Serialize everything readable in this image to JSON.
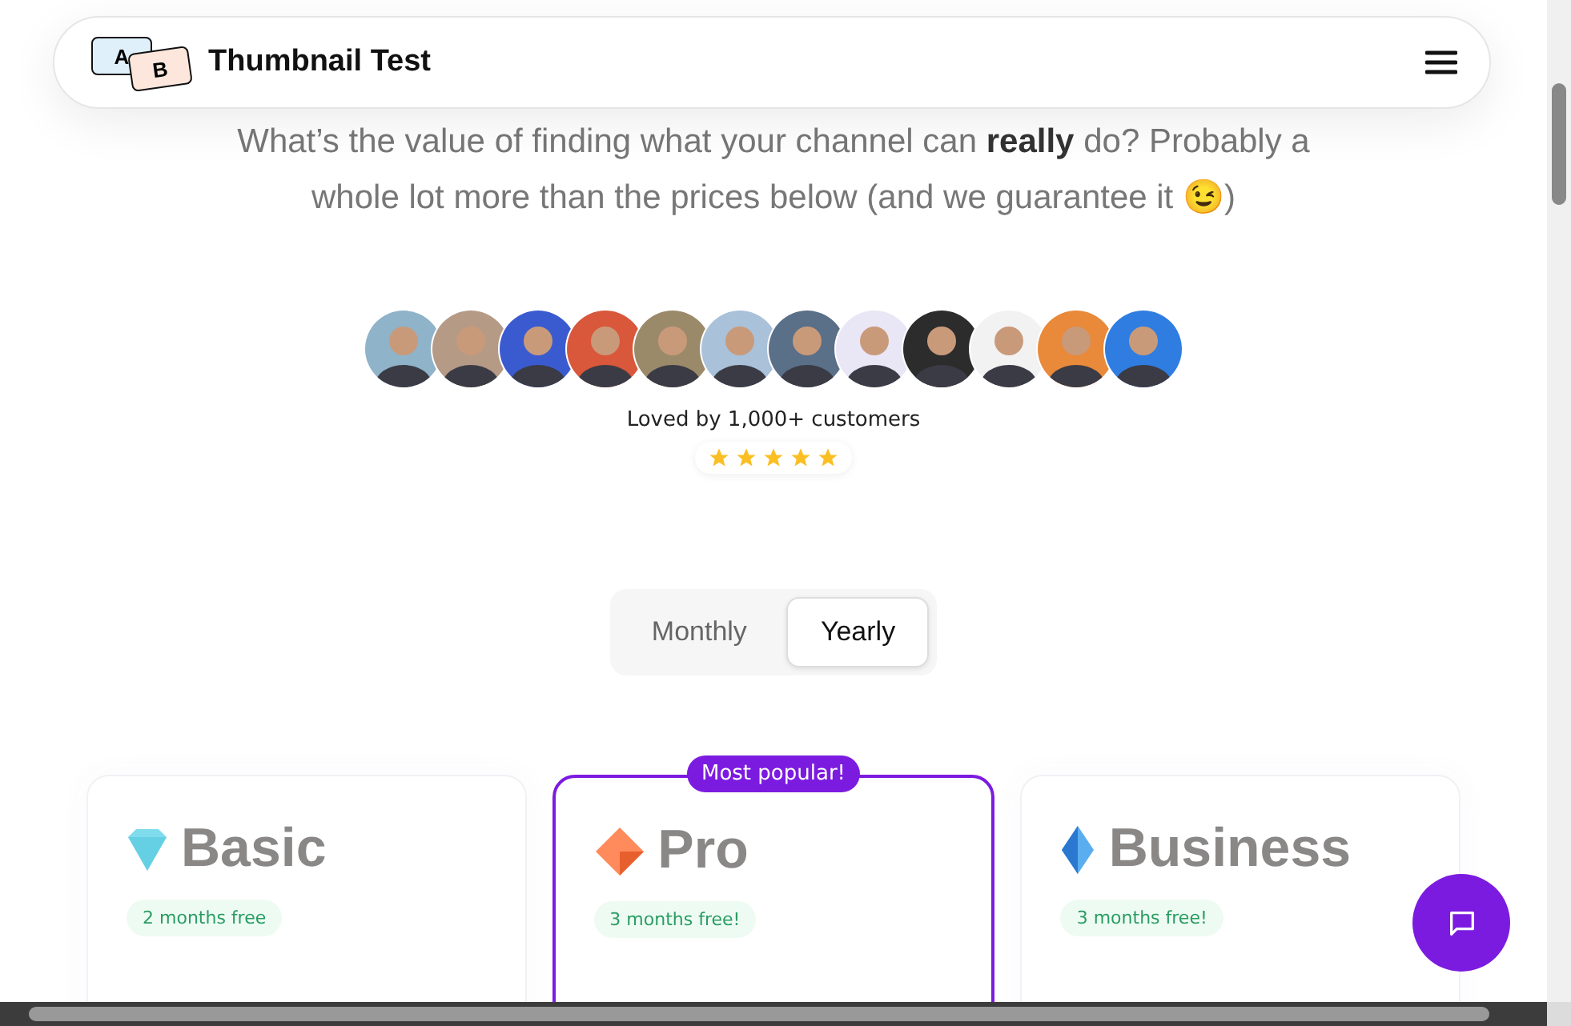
{
  "navbar": {
    "logo_letters": [
      "A",
      "B"
    ],
    "brand": "Thumbnail Test"
  },
  "intro": "What’s the value of finding what your channel can **really** do? Probably a whole lot more than the prices below (and we guarantee it 😉)",
  "social_proof": {
    "avatars": [
      {
        "color": "#8fb3c9"
      },
      {
        "color": "#b59a86"
      },
      {
        "color": "#3a5bd0"
      },
      {
        "color": "#d9573a"
      },
      {
        "color": "#9b8a6a"
      },
      {
        "color": "#a9c1d9"
      },
      {
        "color": "#5a6f88"
      },
      {
        "color": "#e9e6f5"
      },
      {
        "color": "#2c2c2c"
      },
      {
        "color": "#f2f2f2"
      },
      {
        "color": "#e9893a"
      },
      {
        "color": "#2f7de0"
      }
    ],
    "caption": "Loved by 1,000+ customers",
    "stars": 5
  },
  "billing_tabs": [
    {
      "label": "Monthly",
      "selected": false
    },
    {
      "label": "Yearly",
      "selected": true
    }
  ],
  "plans": [
    {
      "name": "Basic",
      "badge": "2 months free",
      "popular": false
    },
    {
      "name": "Pro",
      "badge": "3 months free!",
      "popular": true,
      "popular_label": "Most popular!"
    },
    {
      "name": "Business",
      "badge": "3 months free!",
      "popular": false
    }
  ]
}
